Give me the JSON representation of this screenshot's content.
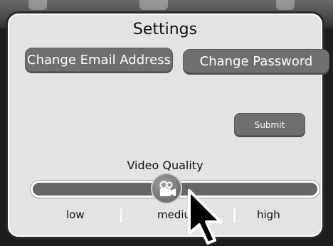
{
  "settings": {
    "title": "Settings",
    "change_email_label": "Change Email Address",
    "change_password_label": "Change Password",
    "submit_label": "Submit"
  },
  "video_quality": {
    "label": "Video Quality",
    "ticks": [
      "low",
      "mediu",
      "high"
    ],
    "value_fraction": 0.47
  },
  "icons": {
    "slider_thumb": "video-camera-icon",
    "pointer": "mouse-pointer-icon"
  },
  "colors": {
    "panel_bg": "#e3e3e3",
    "button_bg": "#6f6f6f",
    "track_bg": "#666666"
  }
}
